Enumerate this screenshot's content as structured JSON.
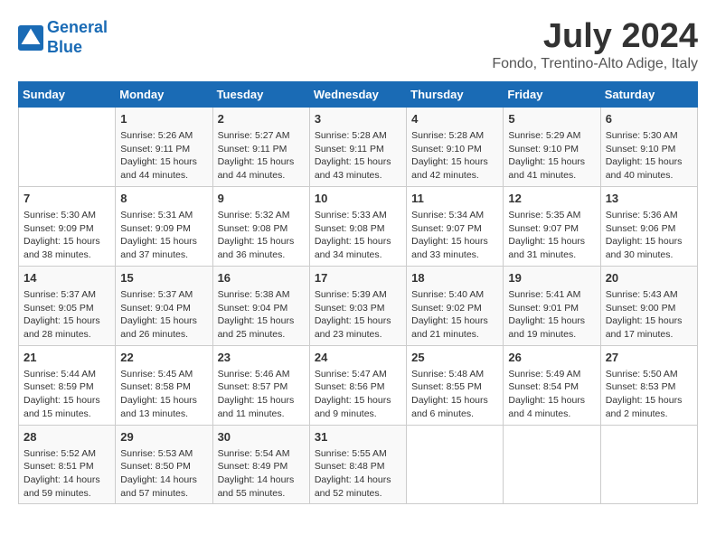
{
  "logo": {
    "line1": "General",
    "line2": "Blue"
  },
  "title": "July 2024",
  "location": "Fondo, Trentino-Alto Adige, Italy",
  "days_header": [
    "Sunday",
    "Monday",
    "Tuesday",
    "Wednesday",
    "Thursday",
    "Friday",
    "Saturday"
  ],
  "weeks": [
    [
      {
        "day": "",
        "info": ""
      },
      {
        "day": "1",
        "info": "Sunrise: 5:26 AM\nSunset: 9:11 PM\nDaylight: 15 hours\nand 44 minutes."
      },
      {
        "day": "2",
        "info": "Sunrise: 5:27 AM\nSunset: 9:11 PM\nDaylight: 15 hours\nand 44 minutes."
      },
      {
        "day": "3",
        "info": "Sunrise: 5:28 AM\nSunset: 9:11 PM\nDaylight: 15 hours\nand 43 minutes."
      },
      {
        "day": "4",
        "info": "Sunrise: 5:28 AM\nSunset: 9:10 PM\nDaylight: 15 hours\nand 42 minutes."
      },
      {
        "day": "5",
        "info": "Sunrise: 5:29 AM\nSunset: 9:10 PM\nDaylight: 15 hours\nand 41 minutes."
      },
      {
        "day": "6",
        "info": "Sunrise: 5:30 AM\nSunset: 9:10 PM\nDaylight: 15 hours\nand 40 minutes."
      }
    ],
    [
      {
        "day": "7",
        "info": "Sunrise: 5:30 AM\nSunset: 9:09 PM\nDaylight: 15 hours\nand 38 minutes."
      },
      {
        "day": "8",
        "info": "Sunrise: 5:31 AM\nSunset: 9:09 PM\nDaylight: 15 hours\nand 37 minutes."
      },
      {
        "day": "9",
        "info": "Sunrise: 5:32 AM\nSunset: 9:08 PM\nDaylight: 15 hours\nand 36 minutes."
      },
      {
        "day": "10",
        "info": "Sunrise: 5:33 AM\nSunset: 9:08 PM\nDaylight: 15 hours\nand 34 minutes."
      },
      {
        "day": "11",
        "info": "Sunrise: 5:34 AM\nSunset: 9:07 PM\nDaylight: 15 hours\nand 33 minutes."
      },
      {
        "day": "12",
        "info": "Sunrise: 5:35 AM\nSunset: 9:07 PM\nDaylight: 15 hours\nand 31 minutes."
      },
      {
        "day": "13",
        "info": "Sunrise: 5:36 AM\nSunset: 9:06 PM\nDaylight: 15 hours\nand 30 minutes."
      }
    ],
    [
      {
        "day": "14",
        "info": "Sunrise: 5:37 AM\nSunset: 9:05 PM\nDaylight: 15 hours\nand 28 minutes."
      },
      {
        "day": "15",
        "info": "Sunrise: 5:37 AM\nSunset: 9:04 PM\nDaylight: 15 hours\nand 26 minutes."
      },
      {
        "day": "16",
        "info": "Sunrise: 5:38 AM\nSunset: 9:04 PM\nDaylight: 15 hours\nand 25 minutes."
      },
      {
        "day": "17",
        "info": "Sunrise: 5:39 AM\nSunset: 9:03 PM\nDaylight: 15 hours\nand 23 minutes."
      },
      {
        "day": "18",
        "info": "Sunrise: 5:40 AM\nSunset: 9:02 PM\nDaylight: 15 hours\nand 21 minutes."
      },
      {
        "day": "19",
        "info": "Sunrise: 5:41 AM\nSunset: 9:01 PM\nDaylight: 15 hours\nand 19 minutes."
      },
      {
        "day": "20",
        "info": "Sunrise: 5:43 AM\nSunset: 9:00 PM\nDaylight: 15 hours\nand 17 minutes."
      }
    ],
    [
      {
        "day": "21",
        "info": "Sunrise: 5:44 AM\nSunset: 8:59 PM\nDaylight: 15 hours\nand 15 minutes."
      },
      {
        "day": "22",
        "info": "Sunrise: 5:45 AM\nSunset: 8:58 PM\nDaylight: 15 hours\nand 13 minutes."
      },
      {
        "day": "23",
        "info": "Sunrise: 5:46 AM\nSunset: 8:57 PM\nDaylight: 15 hours\nand 11 minutes."
      },
      {
        "day": "24",
        "info": "Sunrise: 5:47 AM\nSunset: 8:56 PM\nDaylight: 15 hours\nand 9 minutes."
      },
      {
        "day": "25",
        "info": "Sunrise: 5:48 AM\nSunset: 8:55 PM\nDaylight: 15 hours\nand 6 minutes."
      },
      {
        "day": "26",
        "info": "Sunrise: 5:49 AM\nSunset: 8:54 PM\nDaylight: 15 hours\nand 4 minutes."
      },
      {
        "day": "27",
        "info": "Sunrise: 5:50 AM\nSunset: 8:53 PM\nDaylight: 15 hours\nand 2 minutes."
      }
    ],
    [
      {
        "day": "28",
        "info": "Sunrise: 5:52 AM\nSunset: 8:51 PM\nDaylight: 14 hours\nand 59 minutes."
      },
      {
        "day": "29",
        "info": "Sunrise: 5:53 AM\nSunset: 8:50 PM\nDaylight: 14 hours\nand 57 minutes."
      },
      {
        "day": "30",
        "info": "Sunrise: 5:54 AM\nSunset: 8:49 PM\nDaylight: 14 hours\nand 55 minutes."
      },
      {
        "day": "31",
        "info": "Sunrise: 5:55 AM\nSunset: 8:48 PM\nDaylight: 14 hours\nand 52 minutes."
      },
      {
        "day": "",
        "info": ""
      },
      {
        "day": "",
        "info": ""
      },
      {
        "day": "",
        "info": ""
      }
    ]
  ]
}
